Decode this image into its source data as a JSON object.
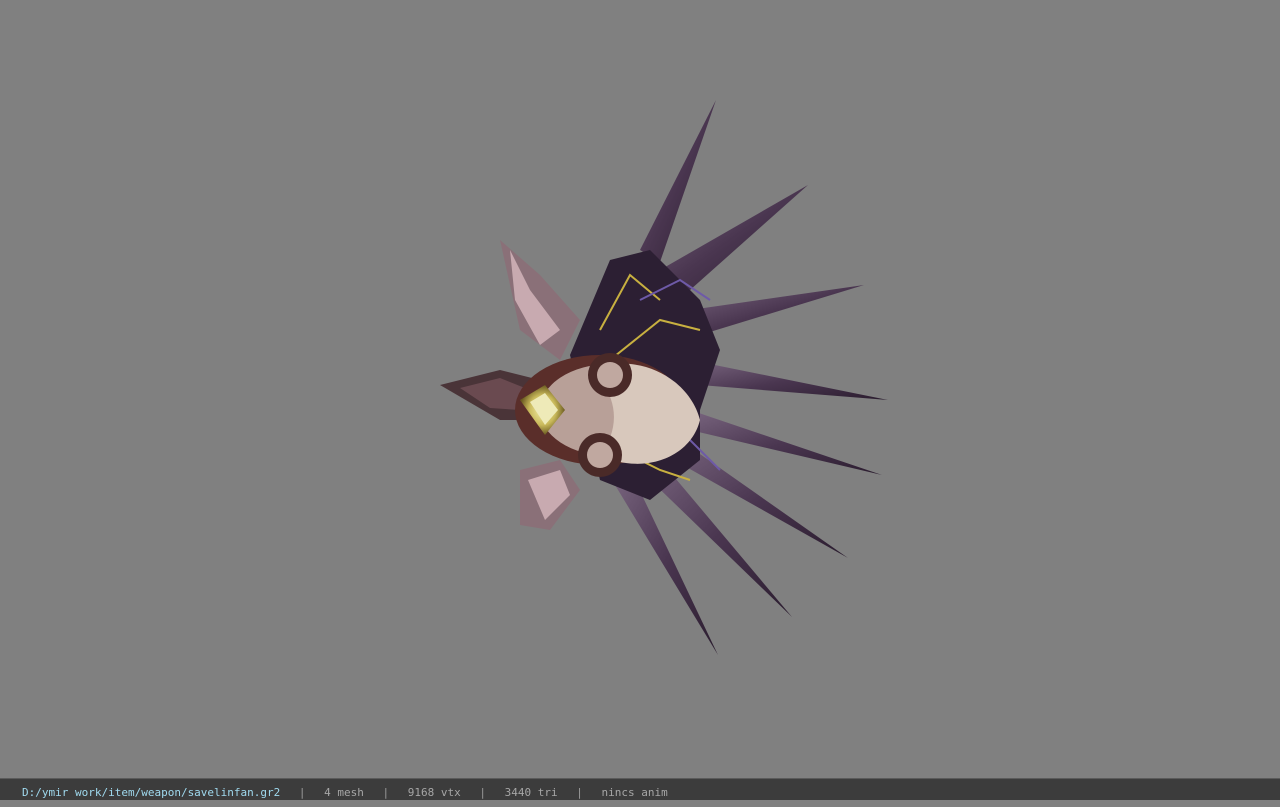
{
  "status_bar": {
    "file_path": "D:/ymir work/item/weapon/savelinfan.gr2",
    "mesh_count": "4 mesh",
    "vertex_count": "9168 vtx",
    "triangle_count": "3440 tri",
    "animation": "nincs anim",
    "separator": "|"
  },
  "viewport": {
    "background_color": "#808080",
    "model_icon": "winged-fan-weapon-model"
  }
}
